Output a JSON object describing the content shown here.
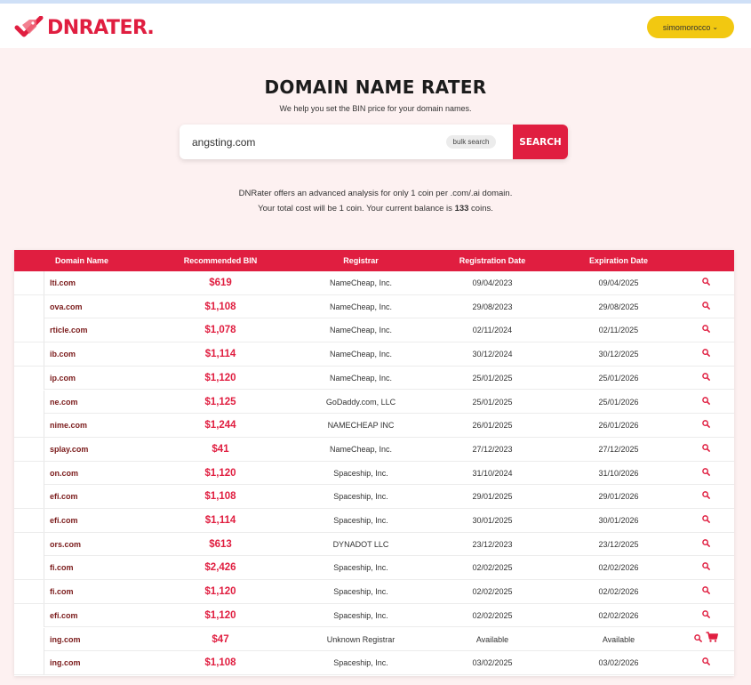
{
  "header": {
    "brand": "DNRATER",
    "user_label": "simomorocco"
  },
  "hero": {
    "title": "DOMAIN NAME RATER",
    "subtitle": "We help you set the BIN price for your domain names."
  },
  "search": {
    "value": "angsting.com",
    "bulk_label": "bulk search",
    "button_label": "SEARCH"
  },
  "info": {
    "line1": "DNRater offers an advanced analysis for only 1 coin per .com/.ai domain.",
    "line2_prefix": "Your total cost will be 1 coin. Your current balance is ",
    "balance": "133",
    "line2_suffix": " coins."
  },
  "table": {
    "headers": [
      "Domain Name",
      "Recommended BIN",
      "Registrar",
      "Registration Date",
      "Expiration Date",
      ""
    ],
    "rows": [
      {
        "domain": "lti.com",
        "bin": "$619",
        "registrar": "NameCheap, Inc.",
        "reg": "09/04/2023",
        "exp": "09/04/2025",
        "cart": false
      },
      {
        "domain": "ova.com",
        "bin": "$1,108",
        "registrar": "NameCheap, Inc.",
        "reg": "29/08/2023",
        "exp": "29/08/2025",
        "cart": false
      },
      {
        "domain": "rticle.com",
        "bin": "$1,078",
        "registrar": "NameCheap, Inc.",
        "reg": "02/11/2024",
        "exp": "02/11/2025",
        "cart": false
      },
      {
        "domain": "ib.com",
        "bin": "$1,114",
        "registrar": "NameCheap, Inc.",
        "reg": "30/12/2024",
        "exp": "30/12/2025",
        "cart": false
      },
      {
        "domain": "ip.com",
        "bin": "$1,120",
        "registrar": "NameCheap, Inc.",
        "reg": "25/01/2025",
        "exp": "25/01/2026",
        "cart": false
      },
      {
        "domain": "ne.com",
        "bin": "$1,125",
        "registrar": "GoDaddy.com, LLC",
        "reg": "25/01/2025",
        "exp": "25/01/2026",
        "cart": false
      },
      {
        "domain": "nime.com",
        "bin": "$1,244",
        "registrar": "NAMECHEAP INC",
        "reg": "26/01/2025",
        "exp": "26/01/2026",
        "cart": false
      },
      {
        "domain": "splay.com",
        "bin": "$41",
        "registrar": "NameCheap, Inc.",
        "reg": "27/12/2023",
        "exp": "27/12/2025",
        "cart": false
      },
      {
        "domain": "on.com",
        "bin": "$1,120",
        "registrar": "Spaceship, Inc.",
        "reg": "31/10/2024",
        "exp": "31/10/2026",
        "cart": false
      },
      {
        "domain": "efi.com",
        "bin": "$1,108",
        "registrar": "Spaceship, Inc.",
        "reg": "29/01/2025",
        "exp": "29/01/2026",
        "cart": false
      },
      {
        "domain": "efi.com",
        "bin": "$1,114",
        "registrar": "Spaceship, Inc.",
        "reg": "30/01/2025",
        "exp": "30/01/2026",
        "cart": false
      },
      {
        "domain": "ors.com",
        "bin": "$613",
        "registrar": "DYNADOT LLC",
        "reg": "23/12/2023",
        "exp": "23/12/2025",
        "cart": false
      },
      {
        "domain": "fi.com",
        "bin": "$2,426",
        "registrar": "Spaceship, Inc.",
        "reg": "02/02/2025",
        "exp": "02/02/2026",
        "cart": false
      },
      {
        "domain": "fi.com",
        "bin": "$1,120",
        "registrar": "Spaceship, Inc.",
        "reg": "02/02/2025",
        "exp": "02/02/2026",
        "cart": false
      },
      {
        "domain": "efi.com",
        "bin": "$1,120",
        "registrar": "Spaceship, Inc.",
        "reg": "02/02/2025",
        "exp": "02/02/2026",
        "cart": false
      },
      {
        "domain": "ing.com",
        "bin": "$47",
        "registrar": "Unknown Registrar",
        "reg": "Available",
        "exp": "Available",
        "cart": true
      },
      {
        "domain": "ing.com",
        "bin": "$1,108",
        "registrar": "Spaceship, Inc.",
        "reg": "03/02/2025",
        "exp": "03/02/2026",
        "cart": false
      }
    ]
  },
  "icons": {
    "search": "search-icon",
    "cart": "cart-icon",
    "logo": "checkmark-tag-logo"
  },
  "colors": {
    "brand_red": "#e01e40",
    "user_yellow": "#f2c811",
    "page_bg": "#fdf1f1"
  }
}
